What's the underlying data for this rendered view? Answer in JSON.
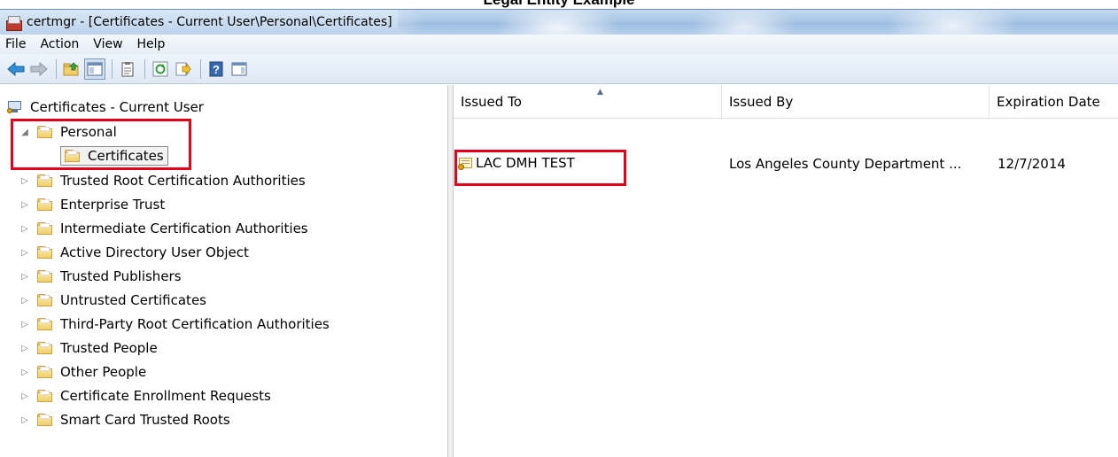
{
  "caption": "Legal Entity Example",
  "window": {
    "title": "certmgr - [Certificates - Current User\\Personal\\Certificates]"
  },
  "menu": {
    "items": [
      "File",
      "Action",
      "View",
      "Help"
    ]
  },
  "toolbar": {
    "buttons": [
      "back-arrow-icon",
      "forward-arrow-icon",
      "up-folder-icon",
      "show-hide-console-tree-icon",
      "properties-icon",
      "refresh-icon",
      "export-list-icon",
      "help-icon",
      "show-hide-action-pane-icon"
    ]
  },
  "tree": {
    "root": "Certificates - Current User",
    "personal": "Personal",
    "personal_child": "Certificates",
    "items": [
      "Trusted Root Certification Authorities",
      "Enterprise Trust",
      "Intermediate Certification Authorities",
      "Active Directory User Object",
      "Trusted Publishers",
      "Untrusted Certificates",
      "Third-Party Root Certification Authorities",
      "Trusted People",
      "Other People",
      "Certificate Enrollment Requests",
      "Smart Card Trusted Roots"
    ]
  },
  "list": {
    "columns": [
      "Issued To",
      "Issued By",
      "Expiration Date"
    ],
    "rows": [
      {
        "issued_to": "LAC DMH TEST",
        "issued_by": "Los Angeles County Department ...",
        "expiration": "12/7/2014"
      }
    ]
  },
  "colors": {
    "highlight_box": "#e2001a",
    "title_gradient": "#a9c6e6"
  }
}
